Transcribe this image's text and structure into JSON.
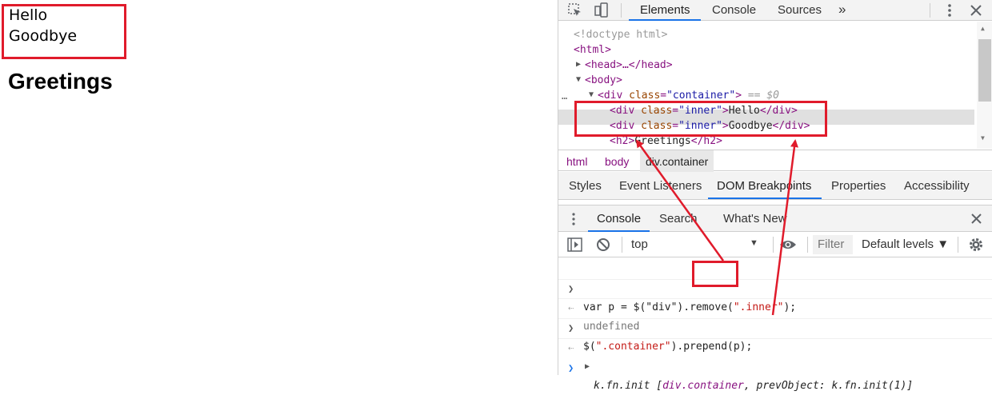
{
  "page": {
    "inner1": "Hello",
    "inner2": "Goodbye",
    "heading": "Greetings"
  },
  "devtools": {
    "tabs": [
      "Elements",
      "Console",
      "Sources"
    ],
    "more": "»",
    "dom": {
      "doctype": "<!doctype html>",
      "html_open": "<html>",
      "head": "<head>…</head>",
      "body_open": "<body>",
      "container_tag_start": "<div ",
      "container_attr": "class",
      "container_val": "\"container\"",
      "container_tag_end": ">",
      "eq0": " == $0",
      "inner_hello": {
        "open": "<div ",
        "attr": "class",
        "eq": "=",
        "val": "\"inner\"",
        "close": ">",
        "text": "Hello",
        "end": "</div>"
      },
      "inner_goodbye": {
        "open": "<div ",
        "attr": "class",
        "eq": "=",
        "val": "\"inner\"",
        "close": ">",
        "text": "Goodbye",
        "end": "</div>"
      },
      "h2": {
        "open": "<h2>",
        "text": "Greetings",
        "end": "</h2>"
      }
    },
    "breadcrumbs": [
      "html",
      "body",
      "div.container"
    ],
    "subtabs": [
      "Styles",
      "Event Listeners",
      "DOM Breakpoints",
      "Properties",
      "Accessibility"
    ],
    "drawer_tabs": [
      "Console",
      "Search",
      "What's New"
    ],
    "console_toolbar": {
      "context": "top",
      "filter_placeholder": "Filter",
      "levels": "Default levels ▼"
    },
    "console": {
      "line1_pre": "var p = $(\"div\").",
      "line1_method": "remove",
      "line1_paren": "(",
      "line1_str": "\".inner\"",
      "line1_post": ");",
      "line2": "undefined",
      "line3_pre": "$(",
      "line3_str": "\".container\"",
      "line3_post": ").prepend(p);",
      "line4_a": "k.fn.init",
      "line4_b": " [",
      "line4_c": "div.container",
      "line4_d": ", prevObject: ",
      "line4_e": "k.fn.init(1)",
      "line4_f": "]"
    }
  },
  "colors": {
    "annotation_red": "#e01b2b",
    "accent_blue": "#1a73e8"
  }
}
